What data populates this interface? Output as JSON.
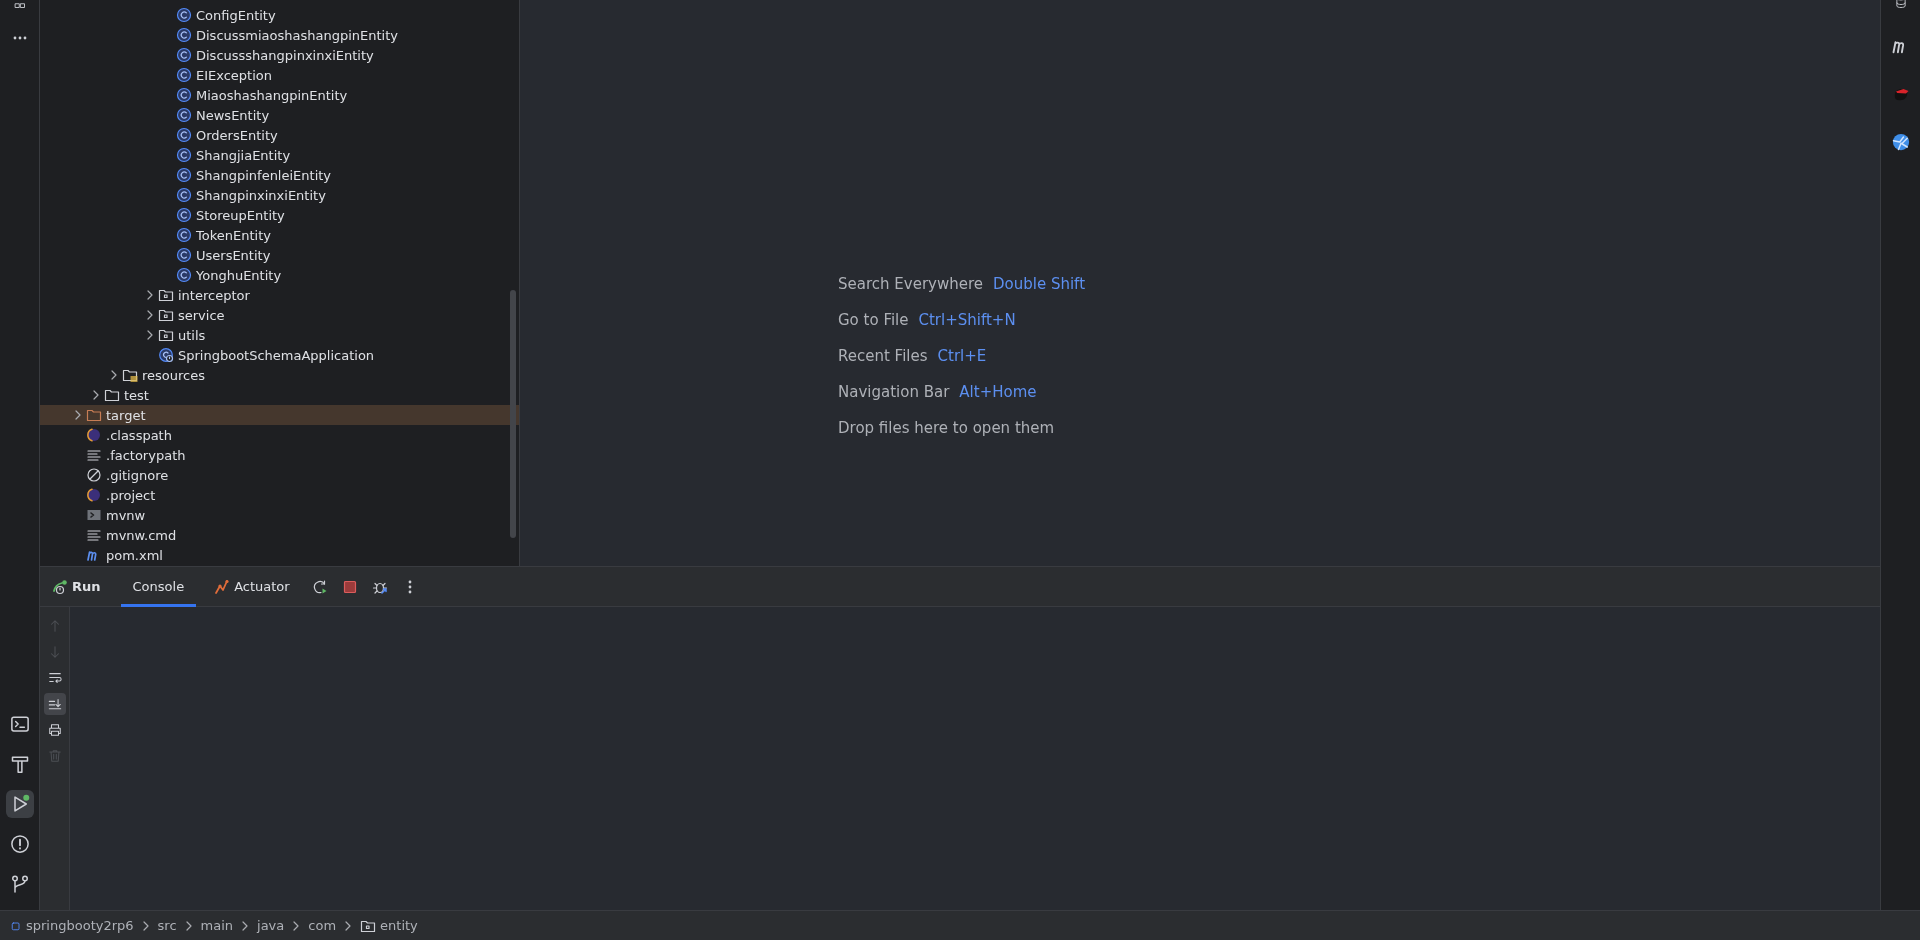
{
  "left_toolbar": {
    "top": [
      {
        "kind": "structure",
        "selected": false
      },
      {
        "kind": "more",
        "selected": false
      }
    ],
    "bottom": [
      {
        "kind": "terminal",
        "selected": false
      },
      {
        "kind": "build",
        "selected": false
      },
      {
        "kind": "run",
        "selected": true
      },
      {
        "kind": "problems",
        "selected": false
      },
      {
        "kind": "git",
        "selected": false
      }
    ]
  },
  "project_tree": [
    {
      "children": [
        {
          "children": [
            {
              "children": [
                {
                  "children": [
                    {
                      "children": [
                        {
                          "label": "ConfigEntity",
                          "kind": "class",
                          "selected": false
                        },
                        {
                          "label": "DiscussmiaoshashangpinEntity",
                          "kind": "class",
                          "selected": false
                        },
                        {
                          "label": "DiscussshangpinxinxiEntity",
                          "kind": "class",
                          "selected": false
                        },
                        {
                          "label": "EIException",
                          "kind": "class",
                          "selected": false
                        },
                        {
                          "label": "MiaoshashangpinEntity",
                          "kind": "class",
                          "selected": false
                        },
                        {
                          "label": "NewsEntity",
                          "kind": "class",
                          "selected": false
                        },
                        {
                          "label": "OrdersEntity",
                          "kind": "class",
                          "selected": false
                        },
                        {
                          "label": "ShangjiaEntity",
                          "kind": "class",
                          "selected": false
                        },
                        {
                          "label": "ShangpinfenleiEntity",
                          "kind": "class",
                          "selected": false
                        },
                        {
                          "label": "ShangpinxinxiEntity",
                          "kind": "class",
                          "selected": false
                        },
                        {
                          "label": "StoreupEntity",
                          "kind": "class",
                          "selected": false
                        },
                        {
                          "label": "TokenEntity",
                          "kind": "class",
                          "selected": false
                        },
                        {
                          "label": "UsersEntity",
                          "kind": "class",
                          "selected": false
                        },
                        {
                          "label": "YonghuEntity",
                          "kind": "class",
                          "selected": false
                        }
                      ]
                    },
                    {
                      "label": "interceptor",
                      "kind": "package",
                      "expanded": false,
                      "selected": false
                    },
                    {
                      "label": "service",
                      "kind": "package",
                      "expanded": false,
                      "selected": false
                    },
                    {
                      "label": "utils",
                      "kind": "package",
                      "expanded": false,
                      "selected": false
                    },
                    {
                      "label": "SpringbootSchemaApplication",
                      "kind": "app",
                      "selected": false
                    }
                  ]
                }
              ]
            },
            {
              "label": "resources",
              "kind": "resources",
              "expanded": false,
              "selected": false
            }
          ]
        },
        {
          "label": "test",
          "kind": "folder",
          "expanded": false,
          "selected": false
        }
      ]
    },
    {
      "label": "target",
      "kind": "excluded",
      "expanded": false,
      "selected": true
    },
    {
      "label": ".classpath",
      "kind": "eclipse",
      "selected": false
    },
    {
      "label": ".factorypath",
      "kind": "text",
      "selected": false
    },
    {
      "label": ".gitignore",
      "kind": "ignore",
      "selected": false
    },
    {
      "label": ".project",
      "kind": "eclipse",
      "selected": false
    },
    {
      "label": "mvnw",
      "kind": "script",
      "selected": false
    },
    {
      "label": "mvnw.cmd",
      "kind": "text",
      "selected": false
    },
    {
      "label": "pom.xml",
      "kind": "maven",
      "selected": false
    }
  ],
  "editor_hints": [
    {
      "action": "Search Everywhere",
      "shortcut": "Double Shift"
    },
    {
      "action": "Go to File",
      "shortcut": "Ctrl+Shift+N"
    },
    {
      "action": "Recent Files",
      "shortcut": "Ctrl+E"
    },
    {
      "action": "Navigation Bar",
      "shortcut": "Alt+Home"
    },
    {
      "action": "Drop files here to open them"
    }
  ],
  "right_toolbar": [
    {
      "kind": "database"
    },
    {
      "kind": "maven"
    },
    {
      "kind": "ninja"
    },
    {
      "kind": "globe"
    }
  ],
  "run_panel": {
    "title": "Run",
    "tabs": [
      {
        "label": "Console",
        "kind": "plain",
        "selected": true
      },
      {
        "label": "Actuator",
        "kind": "actuator",
        "selected": false
      }
    ],
    "actions": [
      {
        "kind": "rerun"
      },
      {
        "kind": "stop"
      },
      {
        "kind": "debug"
      },
      {
        "kind": "more-vertical"
      }
    ],
    "console_toolbar": [
      {
        "kind": "up",
        "disabled": true,
        "selected": false
      },
      {
        "kind": "down",
        "disabled": true,
        "selected": false
      },
      {
        "kind": "wrap",
        "disabled": false,
        "selected": false
      },
      {
        "kind": "scroll-end",
        "disabled": false,
        "selected": true
      },
      {
        "kind": "print",
        "disabled": false,
        "selected": false
      },
      {
        "kind": "trash",
        "disabled": true,
        "selected": false
      }
    ]
  },
  "breadcrumbs": [
    {
      "label": "springbooty2rp6",
      "kind": "project"
    },
    {
      "label": "src",
      "kind": "plain"
    },
    {
      "label": "main",
      "kind": "plain"
    },
    {
      "label": "java",
      "kind": "plain"
    },
    {
      "label": "com",
      "kind": "plain"
    },
    {
      "label": "entity",
      "kind": "package"
    }
  ]
}
